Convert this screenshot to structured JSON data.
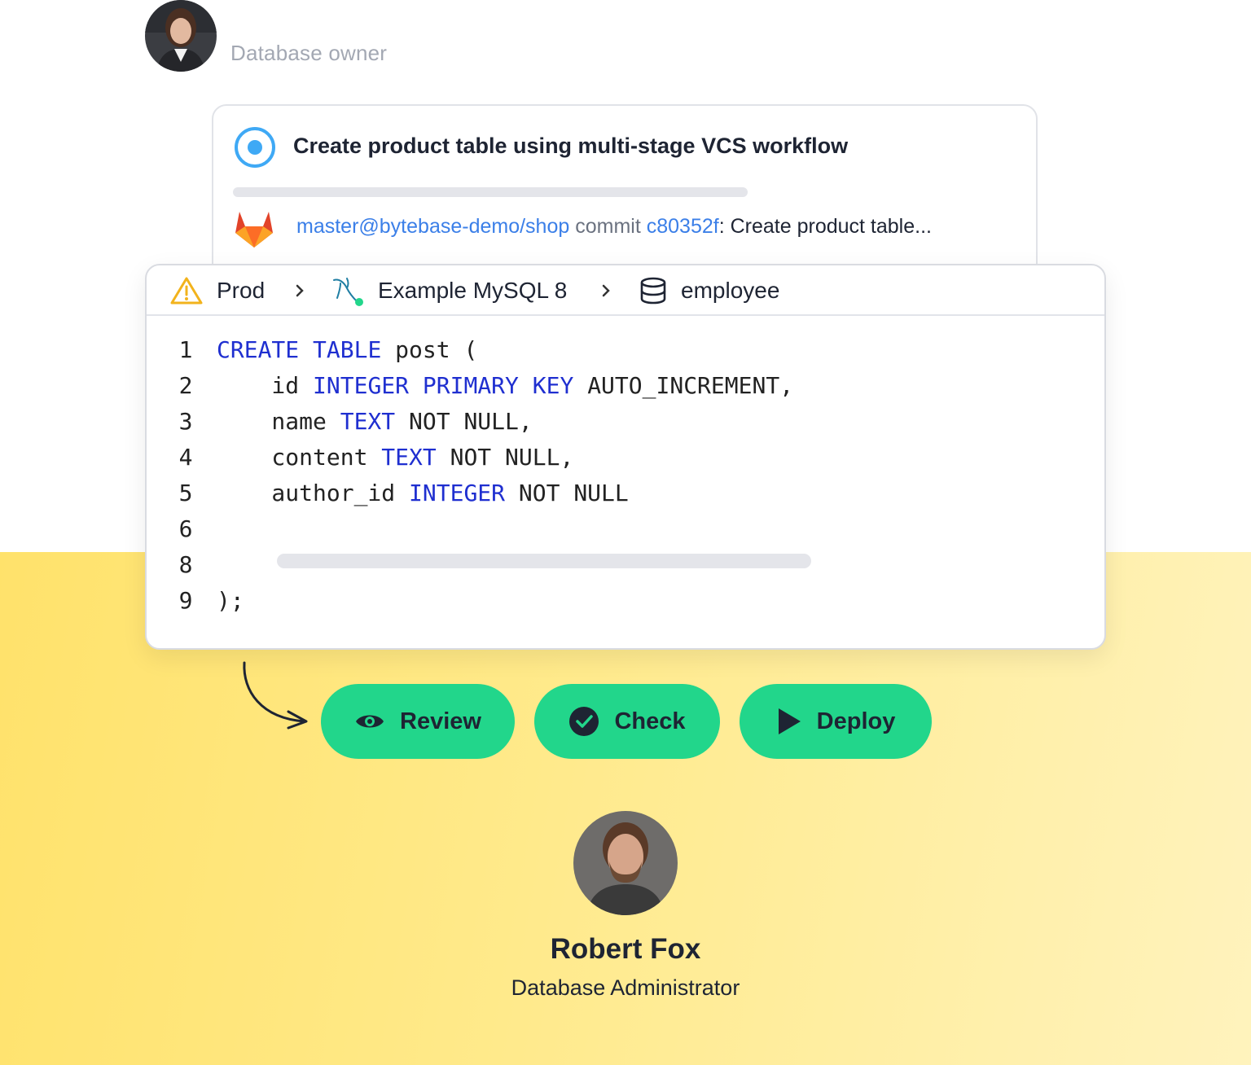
{
  "owner": {
    "label": "Database owner"
  },
  "issue": {
    "title": "Create product table using multi-stage VCS workflow",
    "commit": {
      "branch": "master@bytebase-demo/shop",
      "word": "commit",
      "hash": "c80352f",
      "message": ": Create product table..."
    },
    "status_color": "#3fa9f5"
  },
  "editor": {
    "breadcrumb": {
      "environment": "Prod",
      "instance": "Example MySQL 8",
      "database": "employee"
    },
    "lines": [
      {
        "n": "1",
        "tokens": [
          {
            "t": "CREATE",
            "k": true
          },
          {
            "t": " ",
            "k": false
          },
          {
            "t": "TABLE",
            "k": true
          },
          {
            "t": " post (",
            "k": false
          }
        ]
      },
      {
        "n": "2",
        "tokens": [
          {
            "t": "    id ",
            "k": false
          },
          {
            "t": "INTEGER",
            "k": true
          },
          {
            "t": " ",
            "k": false
          },
          {
            "t": "PRIMARY",
            "k": true
          },
          {
            "t": " ",
            "k": false
          },
          {
            "t": "KEY",
            "k": true
          },
          {
            "t": " AUTO_INCREMENT,",
            "k": false
          }
        ]
      },
      {
        "n": "3",
        "tokens": [
          {
            "t": "    name ",
            "k": false
          },
          {
            "t": "TEXT",
            "k": true
          },
          {
            "t": " NOT NULL,",
            "k": false
          }
        ]
      },
      {
        "n": "4",
        "tokens": [
          {
            "t": "    content ",
            "k": false
          },
          {
            "t": "TEXT",
            "k": true
          },
          {
            "t": " NOT NULL,",
            "k": false
          }
        ]
      },
      {
        "n": "5",
        "tokens": [
          {
            "t": "    author_id ",
            "k": false
          },
          {
            "t": "INTEGER",
            "k": true
          },
          {
            "t": " NOT NULL",
            "k": false
          }
        ]
      },
      {
        "n": "6",
        "tokens": []
      },
      {
        "n": "8",
        "tokens": []
      },
      {
        "n": "9",
        "tokens": [
          {
            "t": ");",
            "k": false
          }
        ]
      }
    ],
    "keyword_color": "#1f2fd0"
  },
  "actions": {
    "review": "Review",
    "check": "Check",
    "deploy": "Deploy",
    "color": "#22d68b"
  },
  "admin": {
    "name": "Robert Fox",
    "role": "Database Administrator"
  }
}
